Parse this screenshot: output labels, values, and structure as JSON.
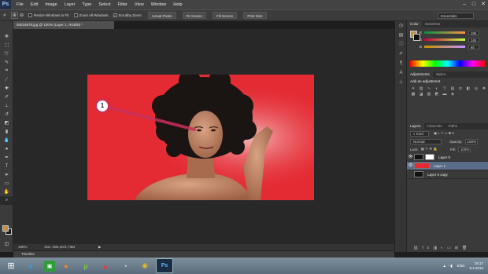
{
  "app": {
    "logo": "Ps"
  },
  "menu": [
    "File",
    "Edit",
    "Image",
    "Layer",
    "Type",
    "Select",
    "Filter",
    "View",
    "Window",
    "Help"
  ],
  "window_controls": [
    "–",
    "□",
    "✕"
  ],
  "options_bar": {
    "checkboxes": [
      {
        "label": "Resize Windows to Fit",
        "checked": false
      },
      {
        "label": "Zoom All Windows",
        "checked": false
      },
      {
        "label": "Scrubby Zoom",
        "checked": true
      }
    ],
    "buttons": [
      "Actual Pixels",
      "Fit Screen",
      "Fill Screen",
      "Print Size"
    ],
    "workspace": "Essentials"
  },
  "document": {
    "tab_title": "00015678.jpg @ 100% (Layer 1, RGB/8) *",
    "status_zoom": "100%",
    "status_doc": "Doc: 602,1K/1,73M",
    "timeline_label": "Timeline"
  },
  "annotation": {
    "number": "1"
  },
  "color_panel": {
    "tabs": [
      "Color",
      "Swatches"
    ],
    "rows": [
      {
        "label": "R",
        "value": "196"
      },
      {
        "label": "G",
        "value": "145"
      },
      {
        "label": "B",
        "value": "65"
      }
    ],
    "foreground": "#c49141"
  },
  "adjustments_panel": {
    "tabs": [
      "Adjustments",
      "Styles"
    ],
    "heading": "Add an adjustment"
  },
  "layers_panel": {
    "tabs": [
      "Layers",
      "Channels",
      "Paths"
    ],
    "kind_label": "Kind",
    "blend_mode": "Normal",
    "opacity_label": "Opacity:",
    "opacity_value": "100%",
    "lock_label": "Lock:",
    "fill_label": "Fill:",
    "fill_value": "100%",
    "layers": [
      {
        "name": "Layer 0",
        "visible": true,
        "selected": false,
        "thumb": "#111111"
      },
      {
        "name": "Layer 1",
        "visible": true,
        "selected": true,
        "thumb": "#e42a33"
      },
      {
        "name": "Layer 0 copy",
        "visible": false,
        "selected": false,
        "thumb": "#111111"
      }
    ]
  },
  "taskbar": {
    "apps": [
      "windows-start",
      "ie",
      "green-app",
      "firefox",
      "utorrent",
      "app6",
      "app7",
      "chrome",
      "photoshop"
    ],
    "language": "ENG",
    "time": "19:17",
    "date": "5.2.2016"
  },
  "colors": {
    "canvas_bg": "#282828",
    "photo_red": "#e42a33",
    "panel_bg": "#3a3a3a",
    "annotation_line": "#c8305a"
  }
}
